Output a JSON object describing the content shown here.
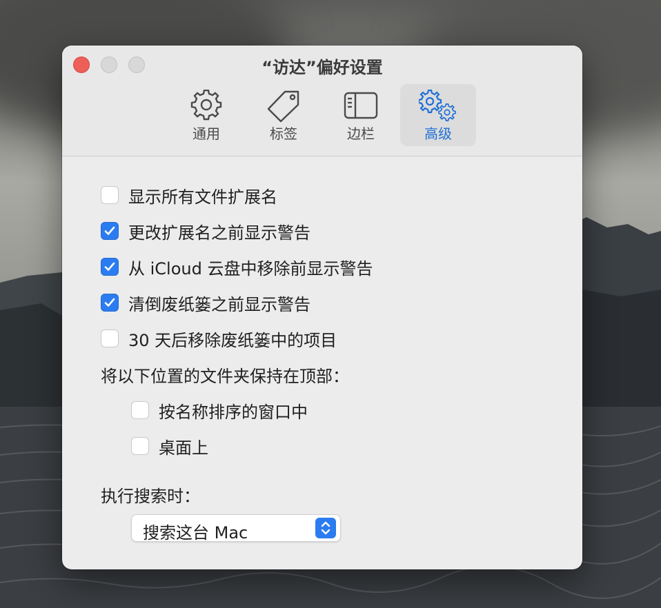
{
  "window": {
    "title": "“访达”偏好设置"
  },
  "toolbar": {
    "tabs": [
      {
        "label": "通用",
        "icon": "gear-icon"
      },
      {
        "label": "标签",
        "icon": "tag-icon"
      },
      {
        "label": "边栏",
        "icon": "sidebar-icon"
      },
      {
        "label": "高级",
        "icon": "gears-icon",
        "selected": true
      }
    ]
  },
  "options": [
    {
      "label": "显示所有文件扩展名",
      "checked": false
    },
    {
      "label": "更改扩展名之前显示警告",
      "checked": true
    },
    {
      "label": "从 iCloud 云盘中移除前显示警告",
      "checked": true
    },
    {
      "label": "清倒废纸篓之前显示警告",
      "checked": true
    },
    {
      "label": "30 天后移除废纸篓中的项目",
      "checked": false
    }
  ],
  "folders_on_top": {
    "heading": "将以下位置的文件夹保持在顶部：",
    "items": [
      {
        "label": "按名称排序的窗口中",
        "checked": false
      },
      {
        "label": "桌面上",
        "checked": false
      }
    ]
  },
  "search": {
    "heading": "执行搜索时：",
    "selected": "搜索这台 Mac"
  },
  "colors": {
    "accent": "#2b7cf0",
    "close": "#ee5f57"
  }
}
